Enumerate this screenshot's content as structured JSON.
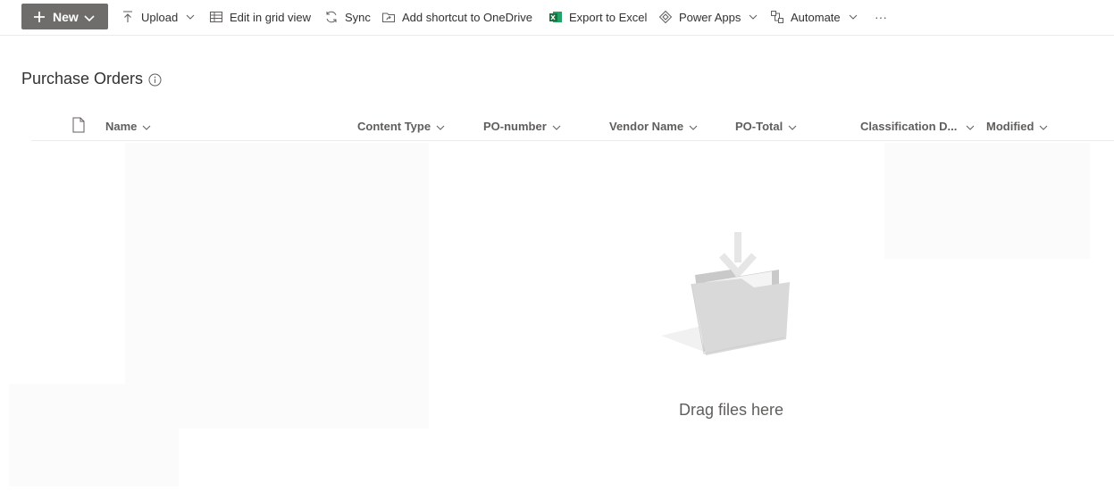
{
  "commandbar": {
    "new_label": "New",
    "upload_label": "Upload",
    "edit_grid_label": "Edit in grid view",
    "sync_label": "Sync",
    "add_shortcut_label": "Add shortcut to OneDrive",
    "export_excel_label": "Export to Excel",
    "power_apps_label": "Power Apps",
    "automate_label": "Automate",
    "more_label": "···"
  },
  "library": {
    "title": "Purchase Orders"
  },
  "columns": {
    "name": "Name",
    "content_type": "Content Type",
    "po_number": "PO-number",
    "vendor_name": "Vendor Name",
    "po_total": "PO-Total",
    "classification": "Classification D...",
    "modified": "Modified"
  },
  "empty_state": {
    "message": "Drag files here"
  },
  "colors": {
    "new_button_bg": "#6e6d6b",
    "text": "#323130",
    "muted_text": "#605e5c",
    "excel_green": "#1d6f42"
  }
}
